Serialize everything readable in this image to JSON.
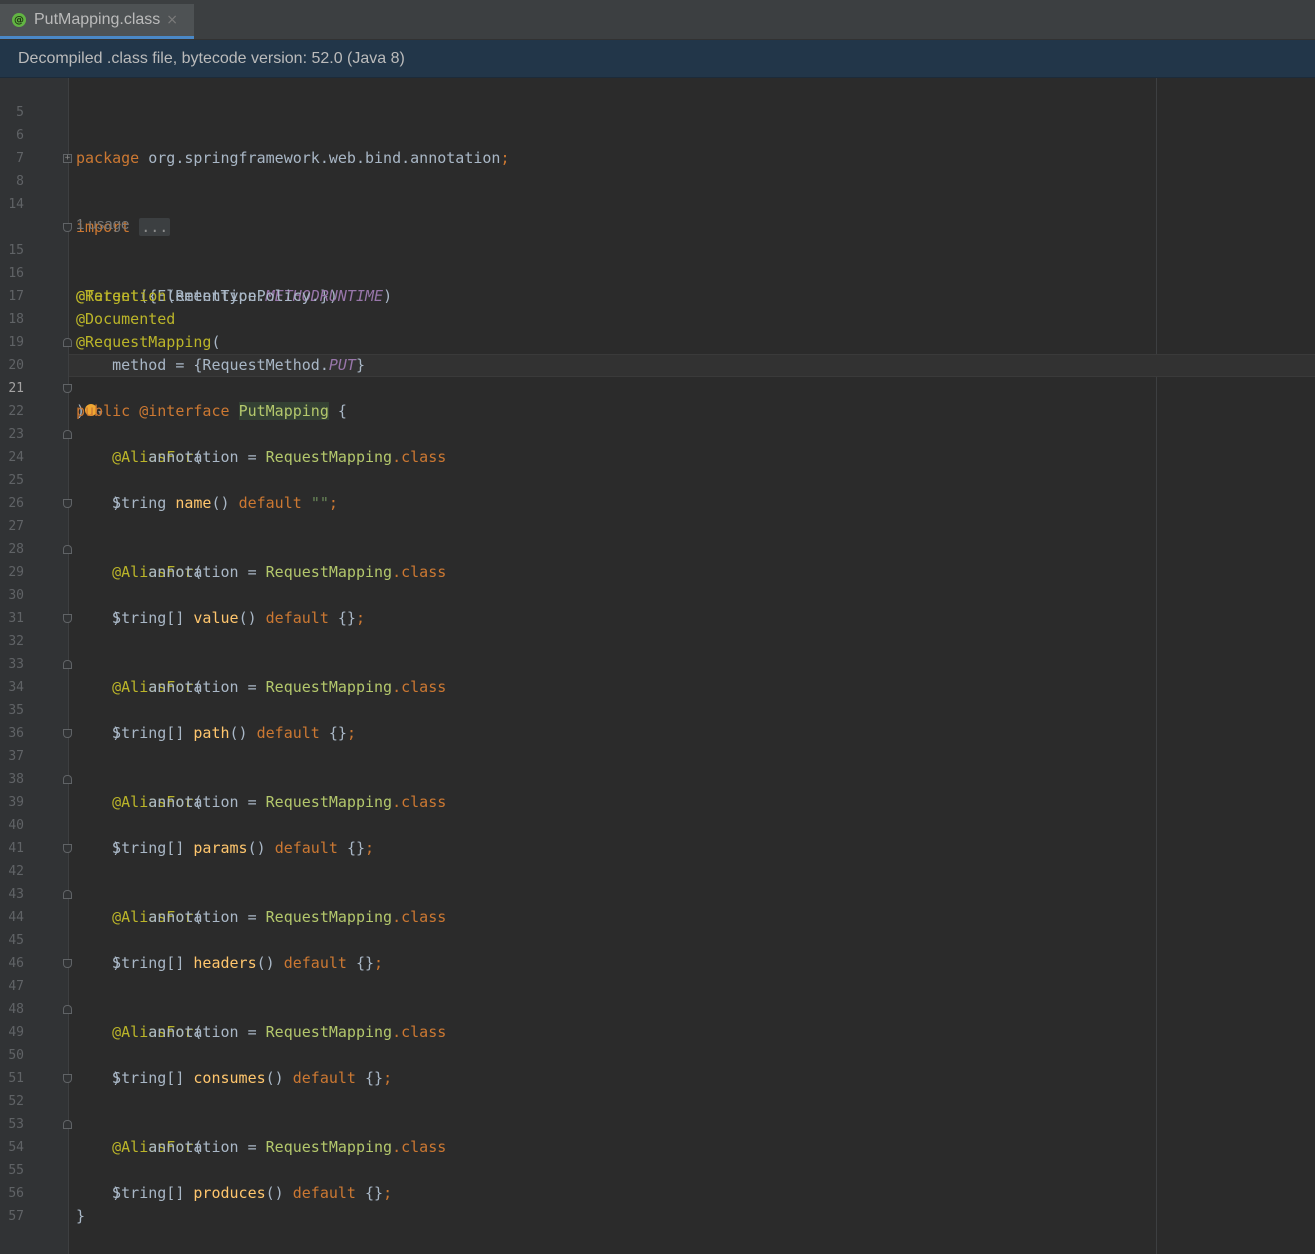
{
  "tab": {
    "icon_letter": "@",
    "label": "PutMapping.class",
    "close": "×"
  },
  "banner": {
    "text": "Decompiled .class file, bytecode version: 52.0 (Java 8)"
  },
  "usage_hint": "1 usage",
  "lines": {
    "n5": "5",
    "n6": "6",
    "n7": "7",
    "n8": "8",
    "n14": "14",
    "n15": "15",
    "n16": "16",
    "n17": "17",
    "n18": "18",
    "n19": "19",
    "n20": "20",
    "n21": "21",
    "n22": "22",
    "n23": "23",
    "n24": "24",
    "n25": "25",
    "n26": "26",
    "n27": "27",
    "n28": "28",
    "n29": "29",
    "n30": "30",
    "n31": "31",
    "n32": "32",
    "n33": "33",
    "n34": "34",
    "n35": "35",
    "n36": "36",
    "n37": "37",
    "n38": "38",
    "n39": "39",
    "n40": "40",
    "n41": "41",
    "n42": "42",
    "n43": "43",
    "n44": "44",
    "n45": "45",
    "n46": "46",
    "n47": "47",
    "n48": "48",
    "n49": "49",
    "n50": "50",
    "n51": "51",
    "n52": "52",
    "n53": "53",
    "n54": "54",
    "n55": "55",
    "n56": "56",
    "n57": "57"
  },
  "code": {
    "package_kw": "package",
    "package_name": " org.springframework.web.bind.annotation",
    "semi": ";",
    "import_kw": "import",
    "import_collapsed": "...",
    "target_ann": "@Target",
    "target_args_open": "({ElementType.",
    "target_const": "METHOD",
    "target_args_close": "})",
    "retention_ann": "@Retention",
    "retention_args_open": "(RetentionPolicy.",
    "retention_const": "RUNTIME",
    "retention_args_close": ")",
    "documented_ann": "@Documented",
    "requestmapping_ann": "@RequestMapping",
    "open_paren": "(",
    "method_assign": "    method = {RequestMethod.",
    "method_const": "PUT",
    "close_brace": "}",
    "close_paren": ")",
    "public_kw": "public",
    "interface_kw": "@interface",
    "interface_name": "PutMapping",
    "open_brace": " {",
    "aliasfor_ann": "@AliasFor",
    "annotation_assign": "annotation = ",
    "rm_class": "RequestMapping",
    "dot_class_kw": ".class",
    "string_type": "String",
    "string_arr_type": "String[]",
    "default_kw": "default",
    "empty_string": "\"\"",
    "empty_braces": "{}",
    "parens": "()",
    "m_name": "name",
    "m_value": "value",
    "m_path": "path",
    "m_params": "params",
    "m_headers": "headers",
    "m_consumes": "consumes",
    "m_produces": "produces",
    "final_brace": "}"
  }
}
